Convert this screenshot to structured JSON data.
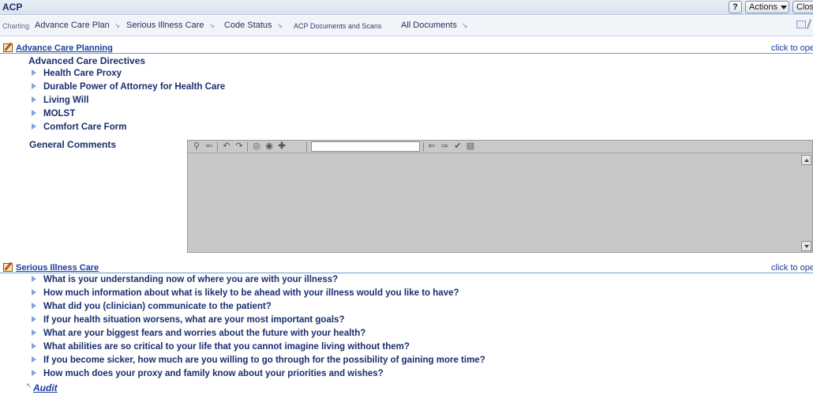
{
  "window": {
    "title": "ACP",
    "help_label": "?",
    "actions_label": "Actions",
    "close_label": "Clos"
  },
  "tabs": [
    {
      "label": "Charting"
    },
    {
      "label": "Advance Care Plan"
    },
    {
      "label": "Serious Illness Care"
    },
    {
      "label": "Code Status"
    },
    {
      "label": "ACP Documents and Scans"
    },
    {
      "label": "All Documents"
    }
  ],
  "acp_section": {
    "title": "Advance Care Planning",
    "open_link": "click to oper",
    "group_title": "Advanced Care Directives",
    "items": [
      {
        "label": "Health Care Proxy"
      },
      {
        "label": "Durable Power of Attorney for Health Care"
      },
      {
        "label": "Living Will"
      },
      {
        "label": "MOLST"
      },
      {
        "label": "Comfort Care Form"
      }
    ],
    "comments_label": "General Comments"
  },
  "sic_section": {
    "title": "Serious Illness Care",
    "open_link": "click to oper",
    "questions": [
      {
        "label": "What is your understanding now of where you are with your illness?"
      },
      {
        "label": "How much information about what is likely to be ahead with your illness would you like to have?"
      },
      {
        "label": "What did you (clinician) communicate to the patient?"
      },
      {
        "label": "If your health situation worsens, what are your most important goals?"
      },
      {
        "label": "What are your biggest fears and worries about the future with your health?"
      },
      {
        "label": "What abilities are so critical to your life that you cannot imagine living without them?"
      },
      {
        "label": "If you become sicker, how much are you willing to go through for the possibility of gaining more time?"
      },
      {
        "label": "How much does your proxy and family know about your priorities and wishes?"
      }
    ]
  },
  "audit_label": "Audit",
  "colors": {
    "accent": "#1b3d9c",
    "text": "#1a2e6e",
    "bullet": "#7fa4dc",
    "editor_bg": "#c8c8c8"
  },
  "icons": {
    "toolbar": [
      "find-icon",
      "spellcheck-icon",
      "undo-icon",
      "redo-icon",
      "template-icon",
      "autotext-icon",
      "add-icon",
      "back-arrow-icon",
      "forward-arrow-icon",
      "sign-icon",
      "save-icon"
    ]
  }
}
